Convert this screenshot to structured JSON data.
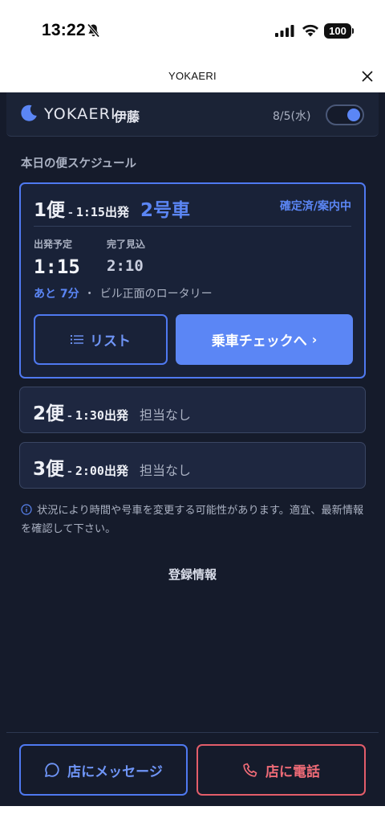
{
  "status_bar": {
    "time": "13:22",
    "battery": "100"
  },
  "browser": {
    "title": "YOKAERI"
  },
  "header": {
    "brand": "YOKAERI",
    "user_name": "伊藤",
    "date": "8/5(水)",
    "toggle_on": true
  },
  "schedule": {
    "section_title": "本日の便スケジュール",
    "trips": [
      {
        "number": "1便",
        "dash": "-",
        "departure_time": "1:15",
        "departure_suffix": "出発",
        "car": "2号車",
        "status": "確定済/案内中",
        "planned_label": "出発予定",
        "planned_value": "1:15",
        "eta_label": "完了見込",
        "eta_value": "2:10",
        "remaining": "あと 7分",
        "separator": "・",
        "location": "ビル正面のロータリー",
        "list_button": "リスト",
        "check_button": "乗車チェックへ",
        "check_chevron": "›"
      },
      {
        "number": "2便",
        "dash": "-",
        "departure_time": "1:30",
        "departure_suffix": "出発",
        "assignee": "担当なし"
      },
      {
        "number": "3便",
        "dash": "-",
        "departure_time": "2:00",
        "departure_suffix": "出発",
        "assignee": "担当なし"
      }
    ]
  },
  "notice": "状況により時間や号車を変更する可能性があります。適宜、最新情報を確認して下さい。",
  "registration_link": "登録情報",
  "footer": {
    "message_button": "店にメッセージ",
    "call_button": "店に電話"
  },
  "colors": {
    "background": "#151b2b",
    "accent": "#5b86f5",
    "danger": "#e35d6a"
  }
}
